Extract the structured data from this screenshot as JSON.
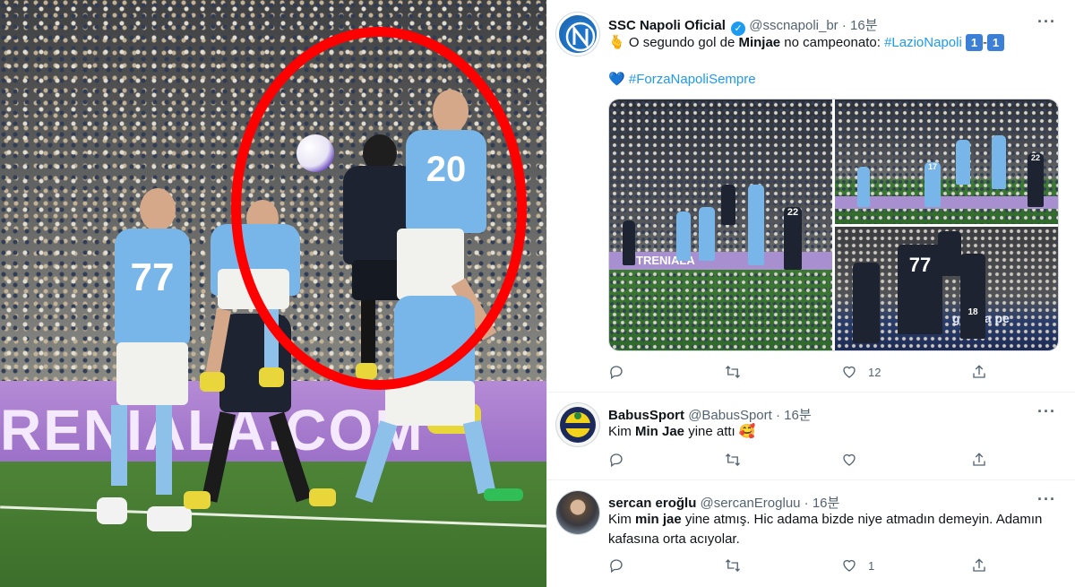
{
  "photo": {
    "adboard_text": "RENIALA.COM",
    "jersey_numbers": [
      "77",
      "20"
    ]
  },
  "tweets": [
    {
      "name": "SSC Napoli Oficial",
      "handle": "@sscnapoli_br",
      "time": "16분",
      "emoji_lead": "🫰",
      "text_pre": "O segundo gol de ",
      "text_bold": "Minjae",
      "text_mid": " no campeonato: ",
      "hashtag1": "#LazioNapoli",
      "score_home": "1",
      "score_sep": "-",
      "score_away": "1",
      "heart_emoji": "💙",
      "hashtag2": "#ForzaNapoliSempre",
      "media_numbers": [
        "22",
        "17",
        "22",
        "77",
        "18"
      ],
      "media_board_text": "TRENIALA",
      "media_board_text2": "genzia pe",
      "likes": "12",
      "avatar_icon": "napoli-logo-icon"
    },
    {
      "name": "BabusSport",
      "handle": "@BabusSport",
      "time": "16분",
      "text_pre": "Kim ",
      "text_bold": "Min Jae",
      "text_post": " yine attı 🥰",
      "avatar_icon": "fenerbahce-crest-icon"
    },
    {
      "name": "sercan eroğlu",
      "handle": "@sercanErogluu",
      "time": "16분",
      "text_pre": "Kim ",
      "text_bold": "min jae",
      "text_post": " yine atmış. Hic adama bizde niye atmadın demeyin. Adamın kafasına orta acıyolar.",
      "likes": "1",
      "avatar_icon": "user-photo-icon"
    }
  ],
  "colors": {
    "link": "#1d9bf0",
    "highlight_ellipse": "#ff0000",
    "lazio_sky": "#78b5e8",
    "napoli_dark": "#1d2330"
  }
}
